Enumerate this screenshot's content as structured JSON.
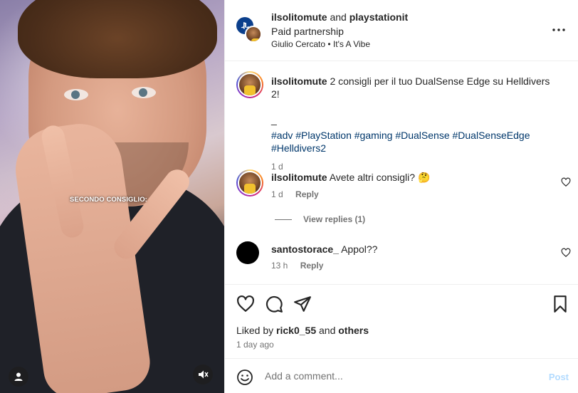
{
  "media": {
    "overlay_caption": "SECONDO CONSIGLIO:"
  },
  "header": {
    "user": "ilsolitomute",
    "and_word": "and",
    "collaborator": "playstationit",
    "subtitle": "Paid partnership",
    "music": "Giulio Cercato • It's A Vibe"
  },
  "caption": {
    "user": "ilsolitomute",
    "text": "2 consigli per il tuo DualSense Edge su Helldivers 2!",
    "separator": "_",
    "hashtags": "#adv #PlayStation #gaming #DualSense #DualSenseEdge #Helldivers2",
    "time": "1 d"
  },
  "comments": [
    {
      "user": "ilsolitomute",
      "text": "Avete altri consigli? 🤔",
      "time": "1 d",
      "reply": "Reply"
    },
    {
      "user": "santostorace_",
      "text": "Appol??",
      "time": "13 h",
      "reply": "Reply"
    }
  ],
  "view_replies": "View replies (1)",
  "likes": {
    "prefix": "Liked by",
    "user": "rick0_55",
    "middle": "and",
    "others": "others"
  },
  "post_age": "1 day ago",
  "composer": {
    "placeholder": "Add a comment...",
    "post_label": "Post"
  },
  "colors": {
    "link": "#00376b",
    "muted": "#737373",
    "post_disabled": "#b3dbff"
  }
}
